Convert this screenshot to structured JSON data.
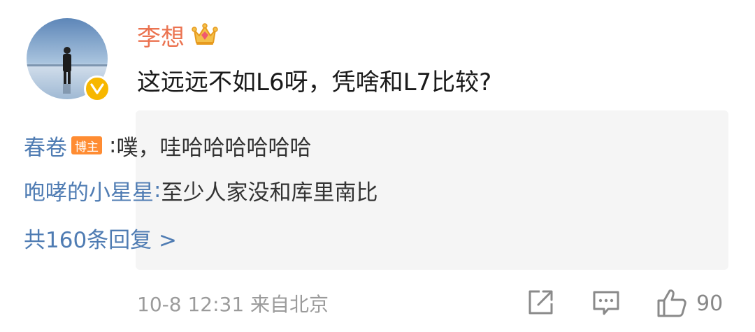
{
  "comment": {
    "username": "李想",
    "text": "这远远不如L6呀，凭啥和L7比较?",
    "crown_icon": "crown-icon",
    "verified_icon": "verified-v-icon"
  },
  "replies": [
    {
      "name": "春卷",
      "badge": "博主",
      "separator": ":",
      "text": " 噗，哇哈哈哈哈哈哈"
    },
    {
      "name": "咆哮的小星星",
      "separator": ":",
      "text": " 至少人家没和库里南比"
    }
  ],
  "more_replies": "共160条回复 >",
  "footer": {
    "time": "10-8 12:31 来自北京",
    "like_count": "90"
  },
  "colors": {
    "username": "#eb7350",
    "reply_name": "#4f7cb3",
    "badge": "#ff8c32",
    "verified": "#f7b700",
    "reply_bg": "#f5f5f5"
  }
}
